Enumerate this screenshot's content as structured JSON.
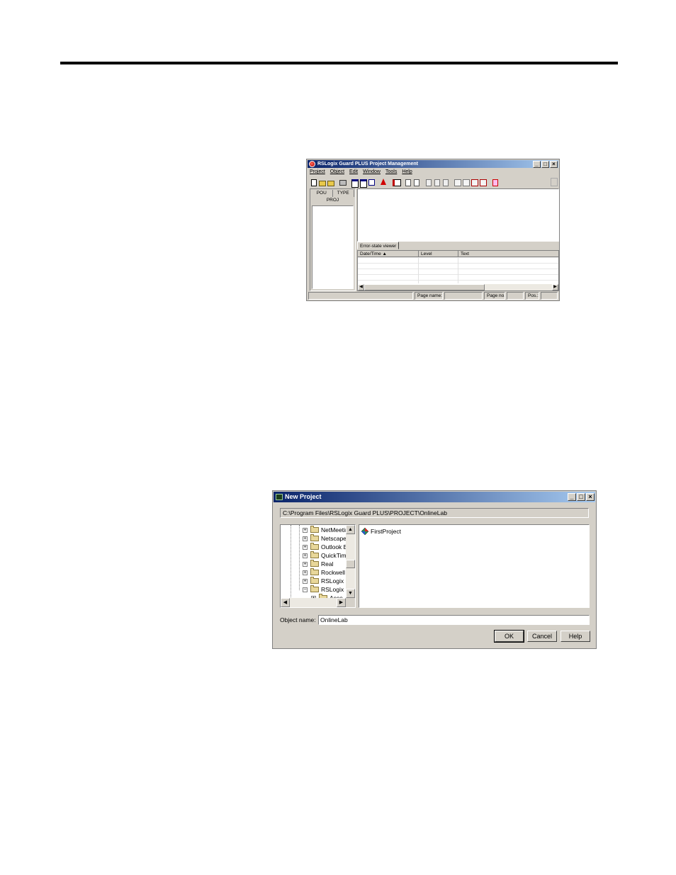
{
  "project_window": {
    "title": "RSLogix Guard PLUS Project Management",
    "menu": [
      "Project",
      "Object",
      "Edit",
      "Window",
      "Tools",
      "Help"
    ],
    "left_tabs": [
      "POU",
      "TYPE"
    ],
    "left_label": "PROJ",
    "viewer_tab": "Error-state viewer",
    "columns": [
      "Date/Time",
      "Level",
      "Text"
    ],
    "status": {
      "page_name": "Page name:",
      "page_no": "Page no.:",
      "pos": "Pos.:"
    }
  },
  "new_project_dialog": {
    "title": "New Project",
    "path": "C:\\Program Files\\RSLogix Guard PLUS\\PROJECT\\OnlineLab",
    "folders": [
      "NetMeetir",
      "Netscape",
      "Outlook E",
      "QuickTim",
      "Real",
      "Rockwell",
      "RSLogix (",
      "RSLogix (",
      "Acce"
    ],
    "projects": [
      "FirstProject"
    ],
    "object_name_label": "Object name:",
    "object_name_value": "OnlineLab",
    "buttons": {
      "ok": "OK",
      "cancel": "Cancel",
      "help": "Help"
    }
  },
  "icons": {
    "app": "rslogix-app-icon",
    "new_project": "new-project-icon",
    "folder": "folder-icon",
    "project": "project-icon"
  }
}
